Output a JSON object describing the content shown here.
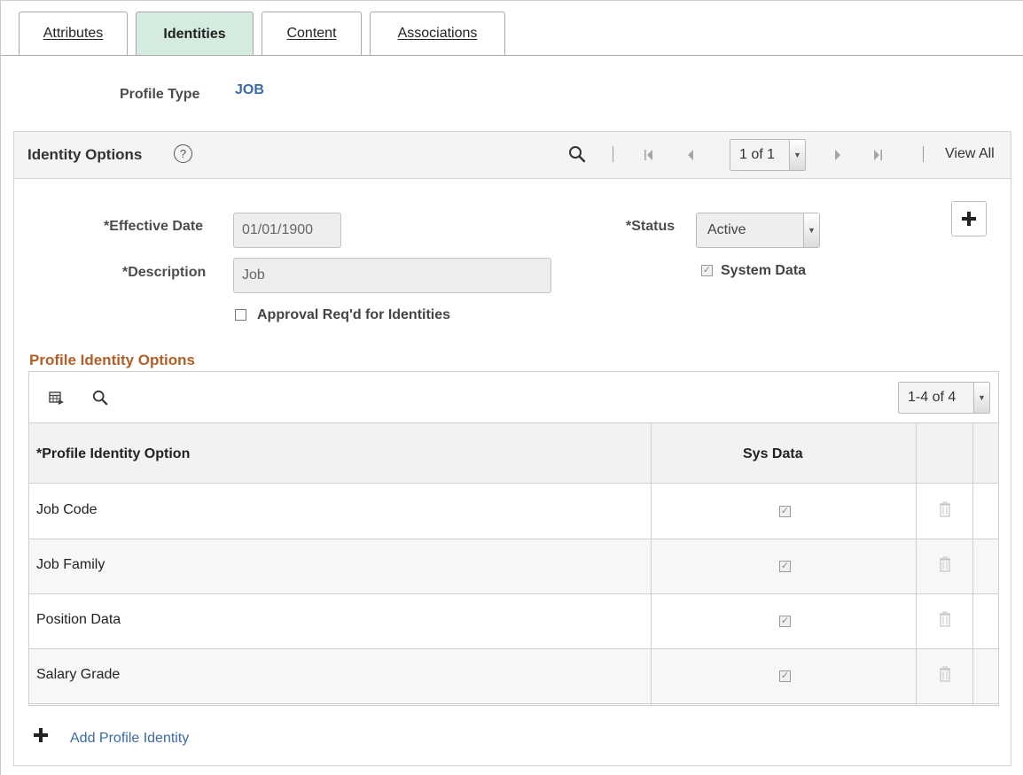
{
  "tabs": [
    {
      "label": "Attributes",
      "active": false
    },
    {
      "label": "Identities",
      "active": true
    },
    {
      "label": "Content",
      "active": false
    },
    {
      "label": "Associations",
      "active": false
    }
  ],
  "profile_type": {
    "label": "Profile Type",
    "value": "JOB"
  },
  "identity_options": {
    "title": "Identity Options",
    "help_icon": "help-circle-icon",
    "pager": {
      "page": "1 of 1",
      "view_all": "View All"
    },
    "effective_date": {
      "label": "*Effective Date",
      "value": "01/01/1900"
    },
    "status": {
      "label": "*Status",
      "value": "Active"
    },
    "description": {
      "label": "*Description",
      "value": "Job"
    },
    "system_data": {
      "label": "System Data",
      "checked": true
    },
    "approval": {
      "label": "Approval Req'd for Identities",
      "checked": false
    }
  },
  "profile_identity_options": {
    "title": "Profile Identity Options",
    "rows_indicator": "1-4 of 4",
    "columns": [
      "*Profile Identity Option",
      "Sys Data"
    ],
    "rows": [
      {
        "option": "Job Code",
        "sys_data": true
      },
      {
        "option": "Job Family",
        "sys_data": true
      },
      {
        "option": "Position Data",
        "sys_data": true
      },
      {
        "option": "Salary Grade",
        "sys_data": true
      }
    ],
    "add_label": "Add Profile Identity"
  },
  "colors": {
    "active_tab": "#d5ebe0",
    "link": "#3a6aa8",
    "subsection_title": "#b35e26"
  }
}
